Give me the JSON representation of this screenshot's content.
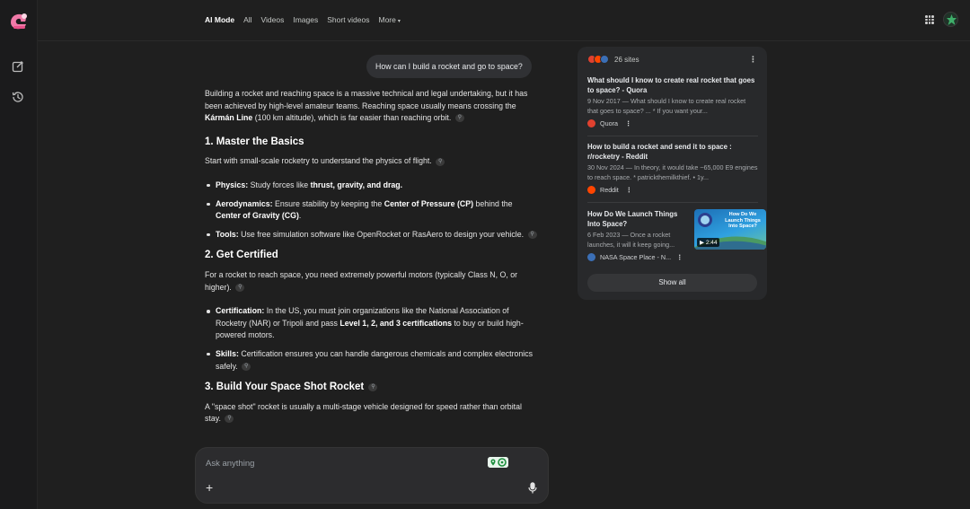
{
  "header": {
    "tabs": [
      {
        "label": "AI Mode",
        "active": true
      },
      {
        "label": "All"
      },
      {
        "label": "Videos"
      },
      {
        "label": "Images"
      },
      {
        "label": "Short videos"
      },
      {
        "label": "More"
      }
    ]
  },
  "chat": {
    "user_query": "How can I build a rocket and go to space?",
    "intro": {
      "t1": "Building a rocket and reaching space is a massive technical and legal undertaking, but it has been achieved by high-level amateur teams. Reaching space usually means crossing the ",
      "b1": "Kármán Line",
      "t2": " (100 km altitude), which is far easier than reaching orbit."
    },
    "s1": {
      "heading": "1. Master the Basics",
      "text": "Start with small-scale rocketry to understand the physics of flight.",
      "b1_label": "Physics:",
      "b1_t1": " Study forces like ",
      "b1_b": "thrust, gravity, and drag.",
      "b2_label": "Aerodynamics:",
      "b2_t1": " Ensure stability by keeping the ",
      "b2_b1": "Center of Pressure (CP)",
      "b2_t2": " behind the ",
      "b2_b2": "Center of Gravity (CG)",
      "b2_t3": ".",
      "b3_label": "Tools:",
      "b3_t1": " Use free simulation software like OpenRocket or RasAero to design your vehicle."
    },
    "s2": {
      "heading": "2. Get Certified",
      "text": "For a rocket to reach space, you need extremely powerful motors (typically Class N, O, or higher).",
      "b1_label": "Certification:",
      "b1_t1": " In the US, you must join organizations like the National Association of Rocketry (NAR) or Tripoli and pass ",
      "b1_b": "Level 1, 2, and 3 certifications",
      "b1_t2": " to buy or build high-powered motors.",
      "b2_label": "Skills:",
      "b2_t1": " Certification ensures you can handle dangerous chemicals and complex electronics safely."
    },
    "s3": {
      "heading": "3. Build Your Space Shot Rocket",
      "text": "A \"space shot\" rocket is usually a multi-stage vehicle designed for speed rather than orbital stay."
    }
  },
  "input": {
    "placeholder": "Ask anything",
    "plus": "+"
  },
  "sources": {
    "count_label": "26 sites",
    "items": [
      {
        "title": "What should I know to create real rocket that goes to space? - Quora",
        "snippet": "9 Nov 2017 — What should I know to create real rocket that goes to space? ... * If you want your...",
        "site": "Quora",
        "color": "#e0412f"
      },
      {
        "title": "How to build a rocket and send it to space : r/rocketry - Reddit",
        "snippet": "30 Nov 2024 — In theory, it would take ~65,000 E9 engines to reach space. * patrickthemilkthief. • 1y...",
        "site": "Reddit",
        "color": "#ff4500"
      },
      {
        "title": "How Do We Launch Things Into Space?",
        "snippet": "6 Feb 2023 — Once a rocket launches, it will it keep going...",
        "site": "NASA Space Place - N...",
        "color": "#3b6fb6",
        "thumb_text": "How Do We Launch Things Into Space?",
        "duration": "2:44"
      }
    ],
    "show_all": "Show all"
  }
}
